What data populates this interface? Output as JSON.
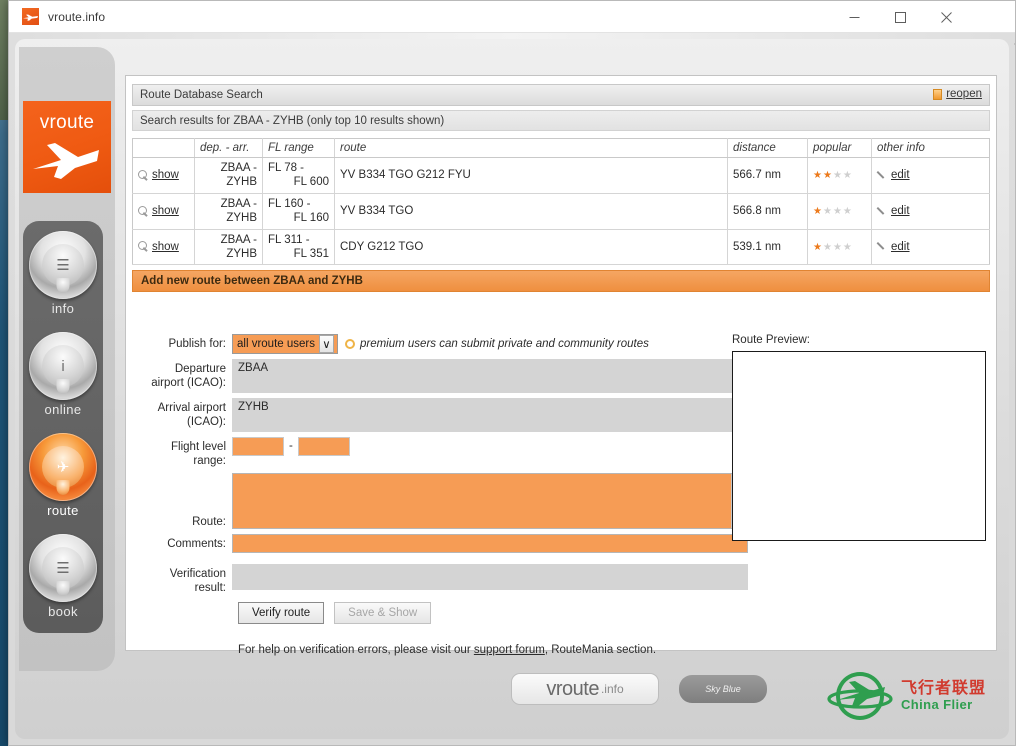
{
  "window": {
    "title": "vroute.info",
    "app_icon": "vroute-logo-icon",
    "minimize_label": "—",
    "maximize_label": "□",
    "close_label": "✕"
  },
  "brand": {
    "word": "vroute",
    "plane_icon": "airplane-icon"
  },
  "nav": {
    "items": [
      {
        "label": "info",
        "glyph": "☰",
        "icon": "document-icon",
        "active": false
      },
      {
        "label": "online",
        "glyph": "i",
        "icon": "info-icon",
        "active": false
      },
      {
        "label": "route",
        "glyph": "✈",
        "icon": "route-icon",
        "active": true
      },
      {
        "label": "book",
        "glyph": "☰",
        "icon": "book-icon",
        "active": false
      }
    ]
  },
  "search": {
    "header_title": "Route Database Search",
    "reopen_label": "reopen",
    "reopen_icon": "window-restore-icon",
    "subheader": "Search results for ZBAA - ZYHB (only top 10 results shown)"
  },
  "results_table": {
    "columns": [
      "",
      "dep. - arr.",
      "FL range",
      "route",
      "distance",
      "popular",
      "other info"
    ],
    "rows": [
      {
        "show_label": "show",
        "dep_line1": "ZBAA -",
        "dep_line2": "ZYHB",
        "fl_line1": "FL 78 -",
        "fl_line2": "FL 600",
        "route": "YV B334 TGO G212 FYU",
        "distance": "566.7 nm",
        "stars_filled": 2,
        "stars_total": 4,
        "edit_label": "edit"
      },
      {
        "show_label": "show",
        "dep_line1": "ZBAA -",
        "dep_line2": "ZYHB",
        "fl_line1": "FL 160 -",
        "fl_line2": "FL 160",
        "route": "YV B334 TGO",
        "distance": "566.8 nm",
        "stars_filled": 1,
        "stars_total": 4,
        "edit_label": "edit"
      },
      {
        "show_label": "show",
        "dep_line1": "ZBAA -",
        "dep_line2": "ZYHB",
        "fl_line1": "FL 311 -",
        "fl_line2": "FL 351",
        "route": "CDY G212 TGO",
        "distance": "539.1 nm",
        "stars_filled": 1,
        "stars_total": 4,
        "edit_label": "edit"
      }
    ]
  },
  "add_route": {
    "section_title": "Add new route between ZBAA and ZYHB",
    "publish_label": "Publish for:",
    "publish_value": "all vroute users",
    "publish_caret": "∨",
    "premium_note": "premium users can submit private and community routes",
    "gear_icon": "gear-icon",
    "departure_label_line1": "Departure",
    "departure_label_line2": "airport (ICAO):",
    "departure_value": "ZBAA",
    "arrival_label_line1": "Arrival airport",
    "arrival_label_line2": "(ICAO):",
    "arrival_value": "ZYHB",
    "fl_label_line1": "Flight level",
    "fl_label_line2": "range:",
    "fl_from": "",
    "fl_to": "",
    "fl_separator": "-",
    "route_label": "Route:",
    "route_value": "",
    "comments_label": "Comments:",
    "comments_value": "",
    "verification_label_line1": "Verification",
    "verification_label_line2": "result:",
    "verification_value": "",
    "verify_button": "Verify route",
    "save_button": "Save & Show",
    "help_prefix": "For help on verification errors, please visit our ",
    "help_link": "support forum",
    "help_suffix": ", RouteMania section.",
    "scroll_up": "∧",
    "scroll_down": "∨"
  },
  "preview": {
    "label": "Route Preview:"
  },
  "footer": {
    "vroute_big": "vroute",
    "vroute_small": ".info",
    "sky_line1": "Sky",
    "sky_line2": "Blue",
    "watermark_icon": "globe-plane-icon",
    "watermark_cn": "飞行者联盟",
    "watermark_en": "China Flier"
  },
  "colors": {
    "brand_orange": "#ef5a12",
    "field_orange": "#f69c55",
    "section_orange": "#ef8f3f",
    "star_on": "#ec7a1c",
    "star_off": "#cfcfcf"
  }
}
